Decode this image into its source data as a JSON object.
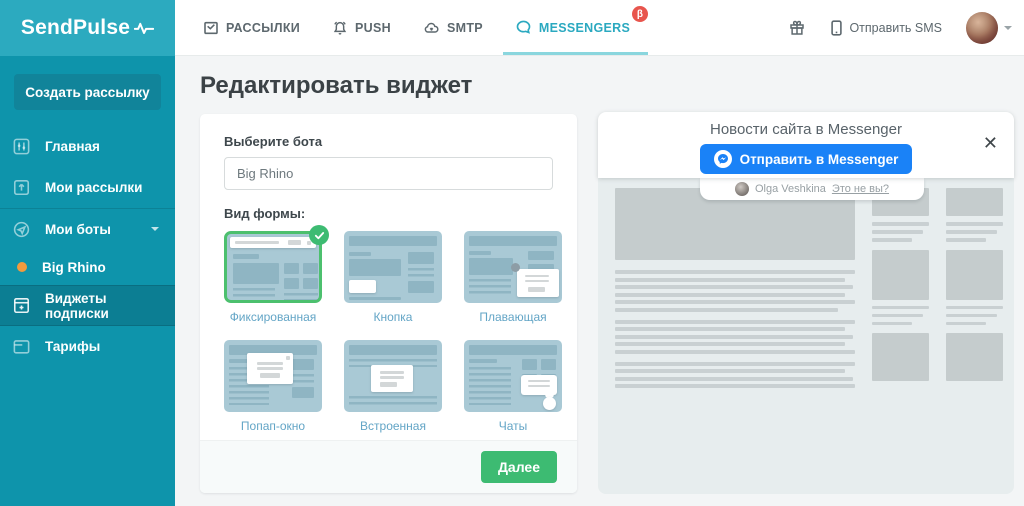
{
  "navbar": {
    "brand": "SendPulse",
    "items": [
      {
        "label": "РАССЫЛКИ"
      },
      {
        "label": "PUSH"
      },
      {
        "label": "SMTP"
      },
      {
        "label": "MESSENGERS",
        "badge": "β"
      }
    ],
    "send_sms_label": "Отправить SMS"
  },
  "sidebar": {
    "create_button_label": "Создать рассылку",
    "items": [
      {
        "label": "Главная"
      },
      {
        "label": "Мои рассылки"
      },
      {
        "label": "Мои боты"
      },
      {
        "label": "Big Rhino"
      },
      {
        "label": "Виджеты подписки"
      },
      {
        "label": "Тарифы"
      }
    ]
  },
  "main": {
    "page_title": "Редактировать виджет",
    "bot_select_label": "Выберите бота",
    "bot_selected": "Big Rhino",
    "form_type_label": "Вид формы:",
    "form_types": [
      "Фиксированная",
      "Кнопка",
      "Плавающая",
      "Попап-окно",
      "Встроенная",
      "Чаты"
    ],
    "next_button_label": "Далее"
  },
  "preview": {
    "widget_title": "Новости сайта в Messenger",
    "messenger_button_label": "Отправить в Messenger",
    "close_glyph": "✕",
    "user_name": "Olga Veshkina",
    "not_you_link": "Это не вы?"
  },
  "colors": {
    "brand_teal": "#2caabf",
    "sidebar_teal": "#0e94ab",
    "sidebar_active": "#0c7e93",
    "accent_green": "#3dbb72",
    "selected_border_green": "#4cc06e",
    "messenger_blue": "#1a82f7",
    "badge_red": "#e8554d",
    "thumb_label_blue": "#63a5c6",
    "orange_dot": "#f29b3e"
  }
}
